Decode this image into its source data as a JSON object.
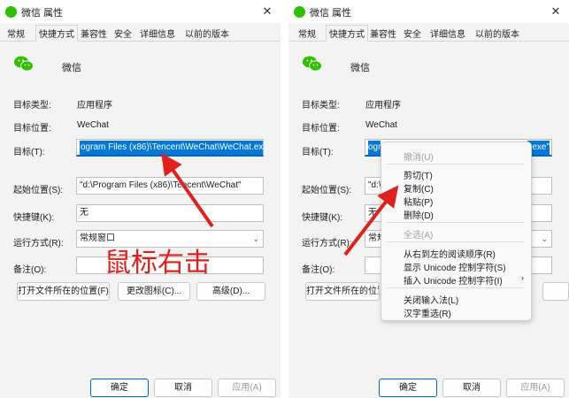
{
  "colors": {
    "accent": "#0078d7",
    "arrow": "#e0201c",
    "wechat_green": "#2dc100"
  },
  "icons": {
    "app": "wechat-icon",
    "close": "close-icon",
    "dropdown": "chevron-down-icon",
    "submenu": "chevron-right-icon"
  },
  "dialog": {
    "title": "微信 属性",
    "close": "✕",
    "tabs": [
      "常规",
      "快捷方式",
      "兼容性",
      "安全",
      "详细信息",
      "以前的版本"
    ],
    "app_name": "微信",
    "target_type_label": "目标类型:",
    "target_type_value": "应用程序",
    "target_location_label": "目标位置:",
    "target_location_value": "WeChat",
    "target_label": "目标(T):",
    "target_value": "ogram Files (x86)\\Tencent\\WeChat\\WeChat.exe\"",
    "target_value_right_a": "ogr",
    "target_value_right_b": "t.exe\"",
    "start_label": "起始位置(S):",
    "start_value": "\"d:\\Program Files (x86)\\Tencent\\WeChat\"",
    "start_value_right": "\"d:\\",
    "hotkey_label": "快捷键(K):",
    "hotkey_value": "无",
    "run_label": "运行方式(R):",
    "run_value": "常规窗口",
    "run_value_right": "常规",
    "comment_label": "备注(O):",
    "comment_value": "",
    "open_location_btn": "打开文件所在的位置(F)",
    "open_location_btn_right": "打开文件所在的位置",
    "change_icon_btn": "更改图标(C)...",
    "advanced_btn": "高级(D)...",
    "ok_btn": "确定",
    "cancel_btn": "取消",
    "apply_btn": "应用(A)"
  },
  "annotation_text": "鼠标右击",
  "context_menu": {
    "items": [
      "撤消(U)",
      "剪切(T)",
      "复制(C)",
      "粘贴(P)",
      "删除(D)",
      "全选(A)",
      "从右到左的阅读顺序(R)",
      "显示 Unicode 控制字符(S)",
      "插入 Unicode 控制字符(I)",
      "关闭输入法(L)",
      "汉字重选(R)"
    ],
    "submenu_arrow": "›"
  }
}
